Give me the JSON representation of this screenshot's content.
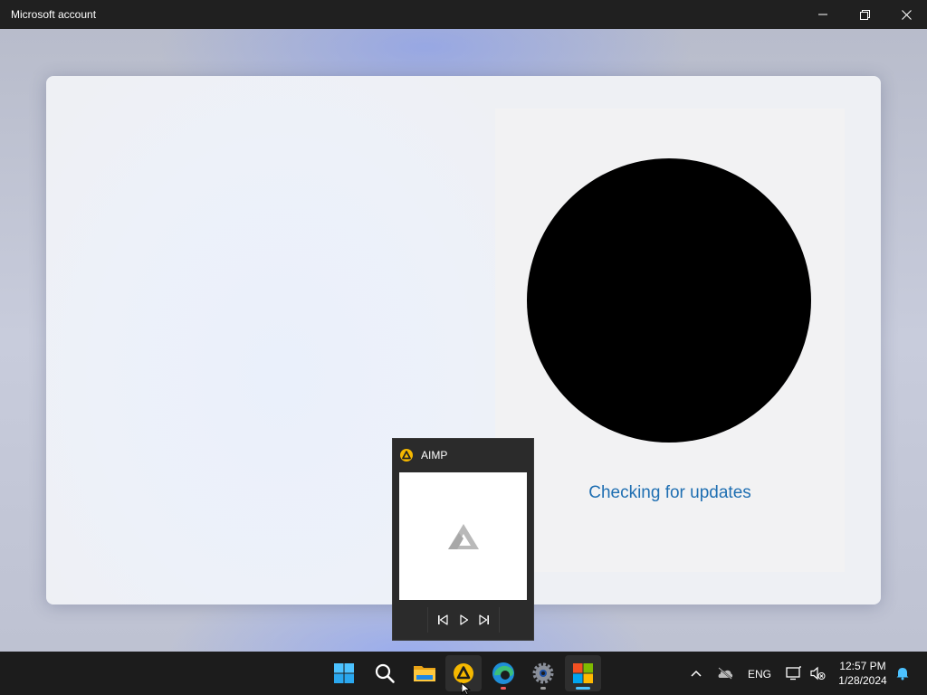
{
  "window": {
    "title": "Microsoft account",
    "controls": [
      "minimize-icon",
      "restore-icon",
      "close-icon"
    ]
  },
  "content": {
    "status_text": "Checking for updates",
    "status_color": "#1f6fb2"
  },
  "aimp_preview": {
    "title": "AIMP",
    "controls": [
      "previous-track-icon",
      "play-icon",
      "next-track-icon"
    ]
  },
  "taskbar": {
    "pinned": [
      {
        "name": "start-icon",
        "active": false
      },
      {
        "name": "search-icon",
        "active": false
      },
      {
        "name": "file-explorer-icon",
        "active": false
      },
      {
        "name": "aimp-icon",
        "active": true
      },
      {
        "name": "edge-icon",
        "active": false
      },
      {
        "name": "settings-icon",
        "active": false
      },
      {
        "name": "microsoft-store-icon",
        "active": true
      }
    ],
    "tray": {
      "language": "ENG",
      "time": "12:57 PM",
      "date": "1/28/2024"
    }
  },
  "colors": {
    "accent": "#4cc2ff",
    "edge_indicator": "#f15b5b",
    "aimp_yellow": "#f5b800"
  }
}
